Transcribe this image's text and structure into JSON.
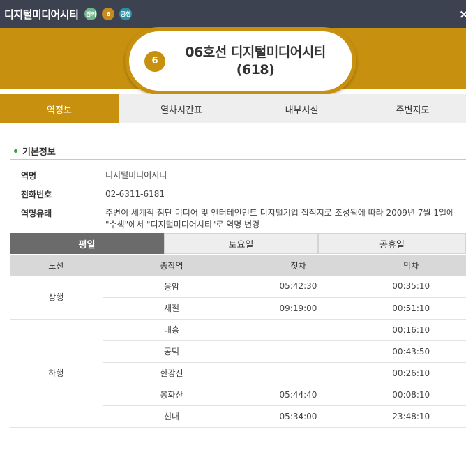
{
  "topbar": {
    "station_name": "디지털미디어시티",
    "badges": [
      "경의",
      "6",
      "공항"
    ],
    "close_label": "×"
  },
  "header": {
    "line_number": "6",
    "station_title": "06호선 디지털미디어시티 (618)"
  },
  "tabs": [
    {
      "label": "역정보"
    },
    {
      "label": "열차시간표"
    },
    {
      "label": "내부시설"
    },
    {
      "label": "주변지도"
    }
  ],
  "basic_info": {
    "title": "기본정보",
    "rows": [
      {
        "label": "역명",
        "value": "디지털미디어시티"
      },
      {
        "label": "전화번호",
        "value": "02-6311-6181"
      },
      {
        "label": "역명유래",
        "value": "주변이 세계적 첨단 미디어 및 엔터테인먼트 디지털기업 집적지로 조성됨에 따라 2009년 7월 1일에 \"수색\"에서 \"디지털미디어시티\"로 역명 변경"
      }
    ]
  },
  "day_tabs": [
    {
      "label": "평일"
    },
    {
      "label": "토요일"
    },
    {
      "label": "공휴일"
    }
  ],
  "timetable": {
    "headers": [
      "노선",
      "종착역",
      "첫차",
      "막차"
    ],
    "directions": [
      {
        "name": "상행",
        "rows": [
          {
            "terminal": "응암",
            "first": "05:42:30",
            "last": "00:35:10"
          },
          {
            "terminal": "새절",
            "first": "09:19:00",
            "last": "00:51:10"
          }
        ]
      },
      {
        "name": "하행",
        "rows": [
          {
            "terminal": "대흥",
            "first": "",
            "last": "00:16:10"
          },
          {
            "terminal": "공덕",
            "first": "",
            "last": "00:43:50"
          },
          {
            "terminal": "한강진",
            "first": "",
            "last": "00:26:10"
          },
          {
            "terminal": "봉화산",
            "first": "05:44:40",
            "last": "00:08:10"
          },
          {
            "terminal": "신내",
            "first": "05:34:00",
            "last": "23:48:10"
          }
        ]
      }
    ]
  }
}
